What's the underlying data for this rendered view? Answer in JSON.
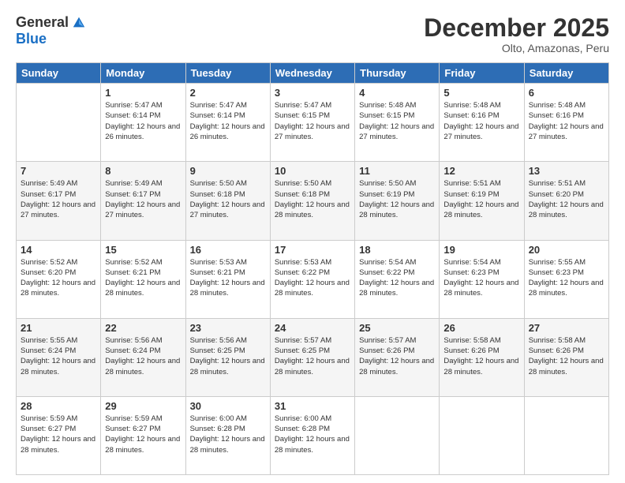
{
  "logo": {
    "general": "General",
    "blue": "Blue"
  },
  "header": {
    "month": "December 2025",
    "location": "Olto, Amazonas, Peru"
  },
  "days": [
    "Sunday",
    "Monday",
    "Tuesday",
    "Wednesday",
    "Thursday",
    "Friday",
    "Saturday"
  ],
  "weeks": [
    [
      {
        "num": "",
        "sunrise": "",
        "sunset": "",
        "daylight": ""
      },
      {
        "num": "1",
        "sunrise": "Sunrise: 5:47 AM",
        "sunset": "Sunset: 6:14 PM",
        "daylight": "Daylight: 12 hours and 26 minutes."
      },
      {
        "num": "2",
        "sunrise": "Sunrise: 5:47 AM",
        "sunset": "Sunset: 6:14 PM",
        "daylight": "Daylight: 12 hours and 26 minutes."
      },
      {
        "num": "3",
        "sunrise": "Sunrise: 5:47 AM",
        "sunset": "Sunset: 6:15 PM",
        "daylight": "Daylight: 12 hours and 27 minutes."
      },
      {
        "num": "4",
        "sunrise": "Sunrise: 5:48 AM",
        "sunset": "Sunset: 6:15 PM",
        "daylight": "Daylight: 12 hours and 27 minutes."
      },
      {
        "num": "5",
        "sunrise": "Sunrise: 5:48 AM",
        "sunset": "Sunset: 6:16 PM",
        "daylight": "Daylight: 12 hours and 27 minutes."
      },
      {
        "num": "6",
        "sunrise": "Sunrise: 5:48 AM",
        "sunset": "Sunset: 6:16 PM",
        "daylight": "Daylight: 12 hours and 27 minutes."
      }
    ],
    [
      {
        "num": "7",
        "sunrise": "Sunrise: 5:49 AM",
        "sunset": "Sunset: 6:17 PM",
        "daylight": "Daylight: 12 hours and 27 minutes."
      },
      {
        "num": "8",
        "sunrise": "Sunrise: 5:49 AM",
        "sunset": "Sunset: 6:17 PM",
        "daylight": "Daylight: 12 hours and 27 minutes."
      },
      {
        "num": "9",
        "sunrise": "Sunrise: 5:50 AM",
        "sunset": "Sunset: 6:18 PM",
        "daylight": "Daylight: 12 hours and 27 minutes."
      },
      {
        "num": "10",
        "sunrise": "Sunrise: 5:50 AM",
        "sunset": "Sunset: 6:18 PM",
        "daylight": "Daylight: 12 hours and 28 minutes."
      },
      {
        "num": "11",
        "sunrise": "Sunrise: 5:50 AM",
        "sunset": "Sunset: 6:19 PM",
        "daylight": "Daylight: 12 hours and 28 minutes."
      },
      {
        "num": "12",
        "sunrise": "Sunrise: 5:51 AM",
        "sunset": "Sunset: 6:19 PM",
        "daylight": "Daylight: 12 hours and 28 minutes."
      },
      {
        "num": "13",
        "sunrise": "Sunrise: 5:51 AM",
        "sunset": "Sunset: 6:20 PM",
        "daylight": "Daylight: 12 hours and 28 minutes."
      }
    ],
    [
      {
        "num": "14",
        "sunrise": "Sunrise: 5:52 AM",
        "sunset": "Sunset: 6:20 PM",
        "daylight": "Daylight: 12 hours and 28 minutes."
      },
      {
        "num": "15",
        "sunrise": "Sunrise: 5:52 AM",
        "sunset": "Sunset: 6:21 PM",
        "daylight": "Daylight: 12 hours and 28 minutes."
      },
      {
        "num": "16",
        "sunrise": "Sunrise: 5:53 AM",
        "sunset": "Sunset: 6:21 PM",
        "daylight": "Daylight: 12 hours and 28 minutes."
      },
      {
        "num": "17",
        "sunrise": "Sunrise: 5:53 AM",
        "sunset": "Sunset: 6:22 PM",
        "daylight": "Daylight: 12 hours and 28 minutes."
      },
      {
        "num": "18",
        "sunrise": "Sunrise: 5:54 AM",
        "sunset": "Sunset: 6:22 PM",
        "daylight": "Daylight: 12 hours and 28 minutes."
      },
      {
        "num": "19",
        "sunrise": "Sunrise: 5:54 AM",
        "sunset": "Sunset: 6:23 PM",
        "daylight": "Daylight: 12 hours and 28 minutes."
      },
      {
        "num": "20",
        "sunrise": "Sunrise: 5:55 AM",
        "sunset": "Sunset: 6:23 PM",
        "daylight": "Daylight: 12 hours and 28 minutes."
      }
    ],
    [
      {
        "num": "21",
        "sunrise": "Sunrise: 5:55 AM",
        "sunset": "Sunset: 6:24 PM",
        "daylight": "Daylight: 12 hours and 28 minutes."
      },
      {
        "num": "22",
        "sunrise": "Sunrise: 5:56 AM",
        "sunset": "Sunset: 6:24 PM",
        "daylight": "Daylight: 12 hours and 28 minutes."
      },
      {
        "num": "23",
        "sunrise": "Sunrise: 5:56 AM",
        "sunset": "Sunset: 6:25 PM",
        "daylight": "Daylight: 12 hours and 28 minutes."
      },
      {
        "num": "24",
        "sunrise": "Sunrise: 5:57 AM",
        "sunset": "Sunset: 6:25 PM",
        "daylight": "Daylight: 12 hours and 28 minutes."
      },
      {
        "num": "25",
        "sunrise": "Sunrise: 5:57 AM",
        "sunset": "Sunset: 6:26 PM",
        "daylight": "Daylight: 12 hours and 28 minutes."
      },
      {
        "num": "26",
        "sunrise": "Sunrise: 5:58 AM",
        "sunset": "Sunset: 6:26 PM",
        "daylight": "Daylight: 12 hours and 28 minutes."
      },
      {
        "num": "27",
        "sunrise": "Sunrise: 5:58 AM",
        "sunset": "Sunset: 6:26 PM",
        "daylight": "Daylight: 12 hours and 28 minutes."
      }
    ],
    [
      {
        "num": "28",
        "sunrise": "Sunrise: 5:59 AM",
        "sunset": "Sunset: 6:27 PM",
        "daylight": "Daylight: 12 hours and 28 minutes."
      },
      {
        "num": "29",
        "sunrise": "Sunrise: 5:59 AM",
        "sunset": "Sunset: 6:27 PM",
        "daylight": "Daylight: 12 hours and 28 minutes."
      },
      {
        "num": "30",
        "sunrise": "Sunrise: 6:00 AM",
        "sunset": "Sunset: 6:28 PM",
        "daylight": "Daylight: 12 hours and 28 minutes."
      },
      {
        "num": "31",
        "sunrise": "Sunrise: 6:00 AM",
        "sunset": "Sunset: 6:28 PM",
        "daylight": "Daylight: 12 hours and 28 minutes."
      },
      {
        "num": "",
        "sunrise": "",
        "sunset": "",
        "daylight": ""
      },
      {
        "num": "",
        "sunrise": "",
        "sunset": "",
        "daylight": ""
      },
      {
        "num": "",
        "sunrise": "",
        "sunset": "",
        "daylight": ""
      }
    ]
  ]
}
